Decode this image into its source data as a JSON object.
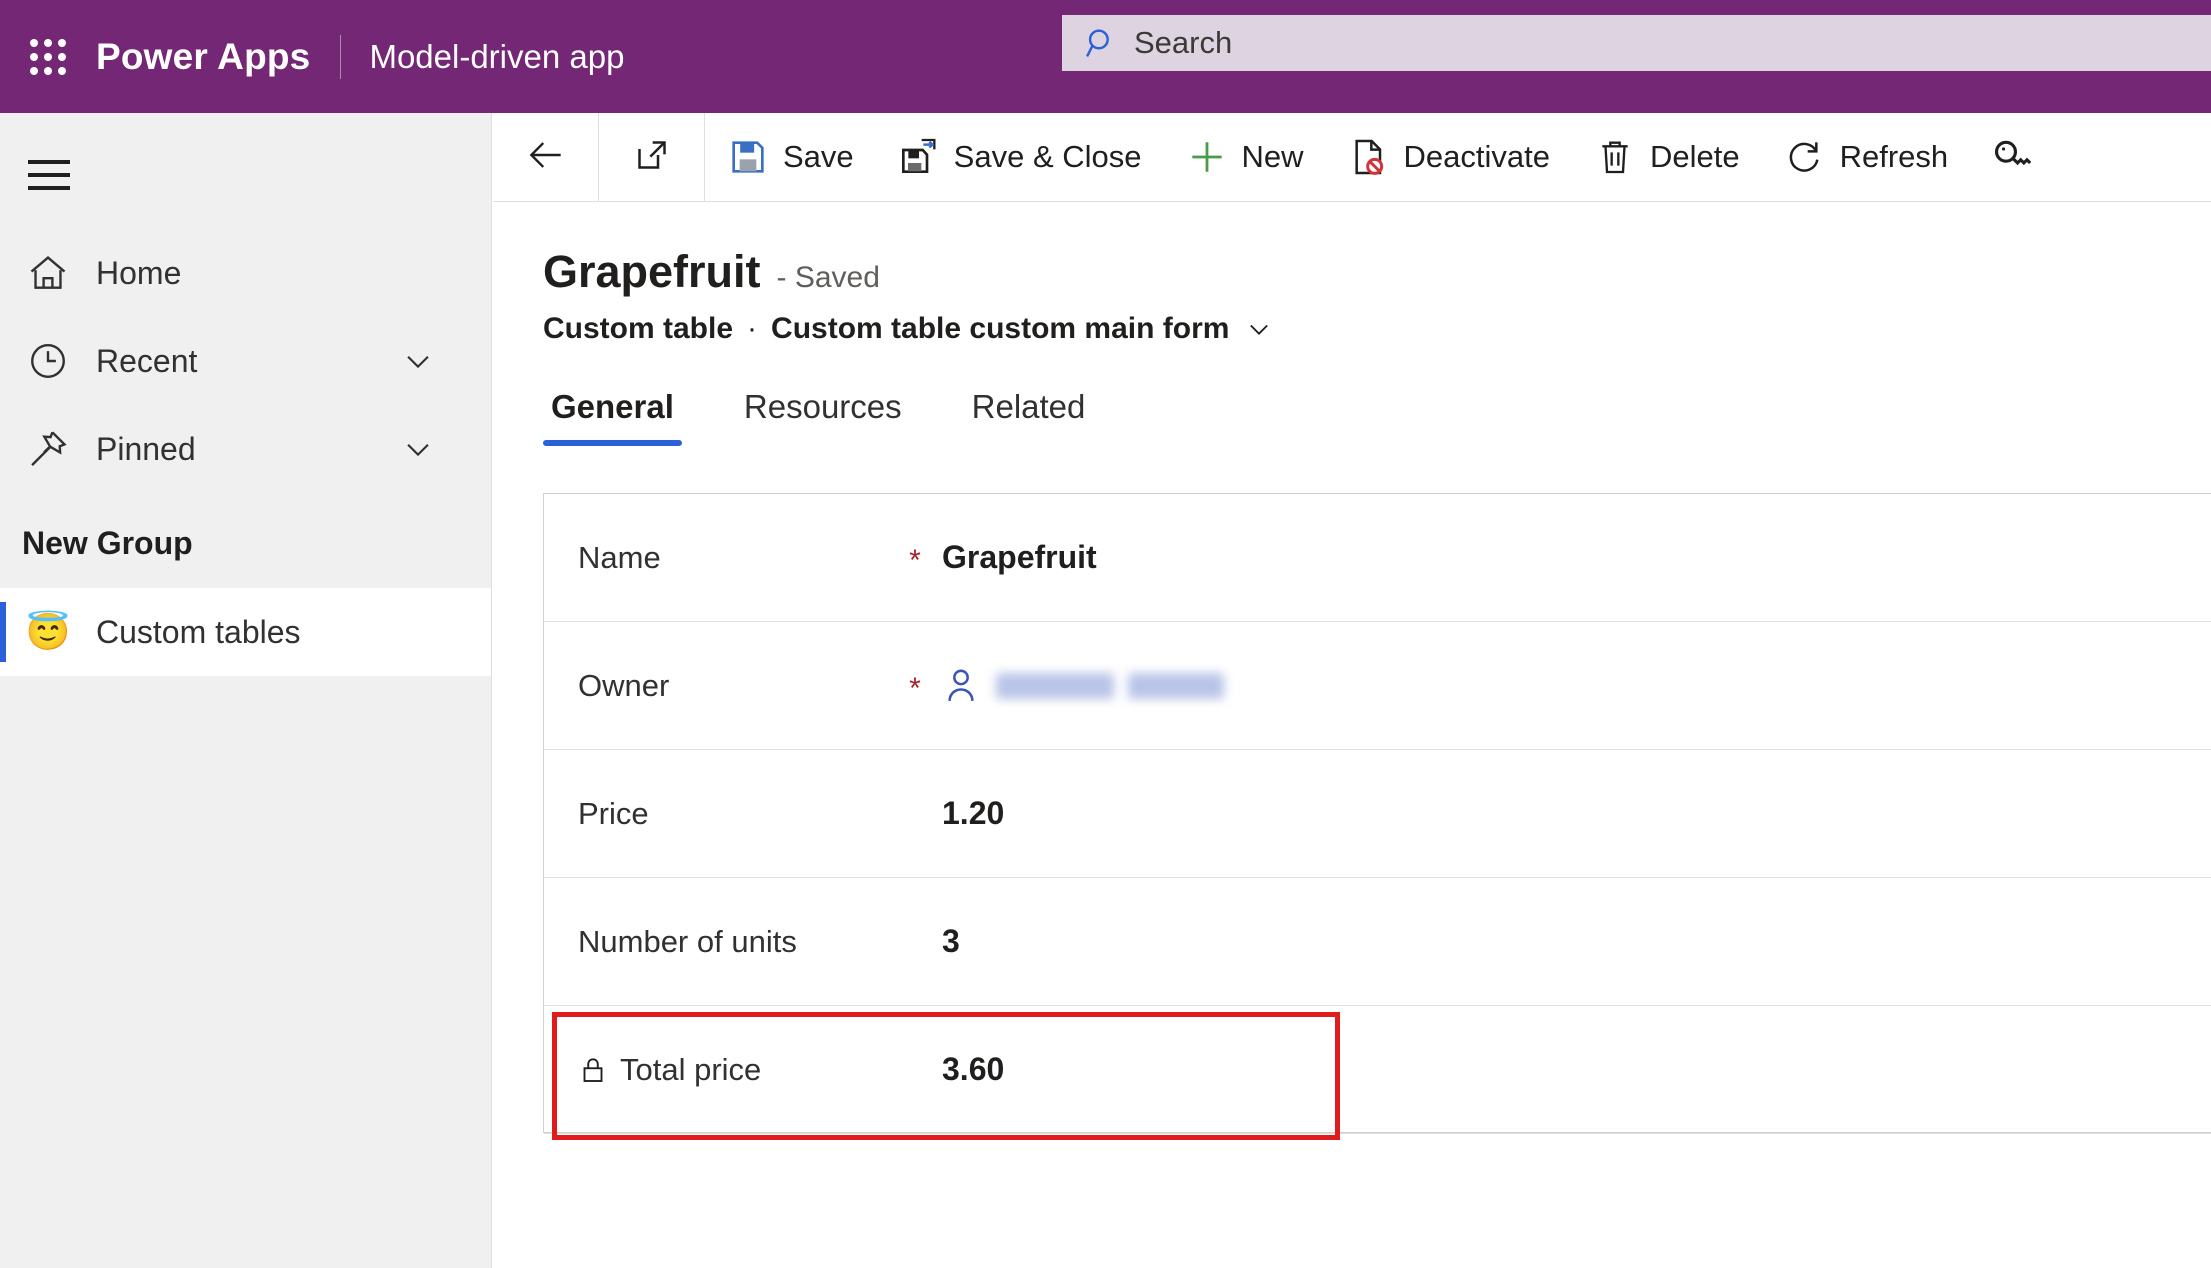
{
  "topbar": {
    "waffle_icon": "waffle-grid-icon",
    "brand": "Power Apps",
    "app_name": "Model-driven app",
    "search": {
      "placeholder": "Search",
      "value": "",
      "icon": "search-icon"
    },
    "background_color": "#742774"
  },
  "sidebar": {
    "hamburger_icon": "hamburger-menu-icon",
    "items": [
      {
        "label": "Home",
        "icon": "home-icon",
        "expandable": false
      },
      {
        "label": "Recent",
        "icon": "clock-icon",
        "expandable": true
      },
      {
        "label": "Pinned",
        "icon": "pin-icon",
        "expandable": true
      }
    ],
    "group_title": "New Group",
    "group_items": [
      {
        "label": "Custom tables",
        "icon": "smiling-face-with-halo-emoji",
        "selected": true
      }
    ],
    "accent_color": "#2a61d8",
    "background_color": "#f0f0f0"
  },
  "commandbar": {
    "back_icon": "back-arrow-icon",
    "popout_icon": "pop-out-icon",
    "buttons": [
      {
        "label": "Save",
        "icon": "save-floppy-icon"
      },
      {
        "label": "Save & Close",
        "icon": "save-and-close-icon"
      },
      {
        "label": "New",
        "icon": "plus-icon"
      },
      {
        "label": "Deactivate",
        "icon": "deactivate-icon"
      },
      {
        "label": "Delete",
        "icon": "trash-icon"
      },
      {
        "label": "Refresh",
        "icon": "refresh-icon"
      }
    ],
    "overflow_icon": "key-icon"
  },
  "record": {
    "title": "Grapefruit",
    "status": "- Saved",
    "entity_name": "Custom table",
    "separator": "·",
    "form_name": "Custom table custom main form",
    "form_chevron_icon": "chevron-down-icon"
  },
  "tabs": [
    {
      "label": "General",
      "active": true
    },
    {
      "label": "Resources",
      "active": false
    },
    {
      "label": "Related",
      "active": false
    }
  ],
  "form": {
    "fields": [
      {
        "label": "Name",
        "required": "*",
        "value": "Grapefruit",
        "locked": false,
        "type": "text"
      },
      {
        "label": "Owner",
        "required": "*",
        "value": "",
        "locked": false,
        "type": "lookup",
        "icon": "person-icon",
        "redacted": true
      },
      {
        "label": "Price",
        "required": "",
        "value": "1.20",
        "locked": false,
        "type": "number"
      },
      {
        "label": "Number of units",
        "required": "",
        "value": "3",
        "locked": false,
        "type": "number"
      },
      {
        "label": "Total price",
        "required": "",
        "value": "3.60",
        "locked": true,
        "lock_icon": "lock-icon",
        "type": "number"
      }
    ]
  },
  "annotation": {
    "highlight_color": "#e01b1b",
    "target_field": "Total price"
  }
}
